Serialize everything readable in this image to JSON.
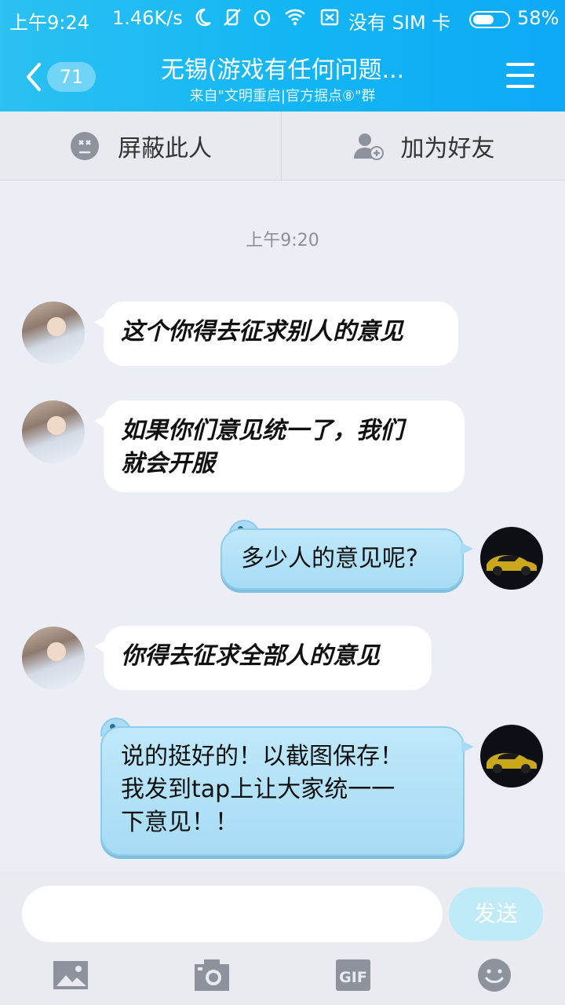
{
  "status_bar": {
    "time": "上午9:24",
    "speed": "1.46K/s",
    "carrier": "没有 SIM 卡",
    "battery_percent": "58%",
    "battery_level": 0.58
  },
  "nav": {
    "back_badge": "71",
    "title": "无锡(游戏有任何问题...",
    "subtitle": "来自\"文明重启|官方据点⑧\"群"
  },
  "actions": {
    "block_label": "屏蔽此人",
    "add_friend_label": "加为好友"
  },
  "chat": {
    "timestamp": "上午9:20",
    "messages": [
      {
        "side": "in",
        "text": "这个你得去征求别人的意见"
      },
      {
        "side": "in",
        "text_lines": [
          "如果你们意见统一了，我们",
          "就会开服"
        ]
      },
      {
        "side": "out",
        "text": "多少人的意见呢?"
      },
      {
        "side": "in",
        "text": "你得去征求全部人的意见"
      },
      {
        "side": "out",
        "text_lines": [
          "说的挺好的！以截图保存！",
          "我发到tap上让大家统一一",
          "下意见！！"
        ]
      }
    ]
  },
  "input": {
    "placeholder": "",
    "send_label": "发送"
  },
  "toolbar_icons": [
    "image-icon",
    "camera-icon",
    "gif-icon",
    "emoji-icon"
  ],
  "colors": {
    "header_accent": "#12b5f4",
    "outgoing_bubble": "#a7dcf5",
    "send_button": "#bfeaf8"
  }
}
